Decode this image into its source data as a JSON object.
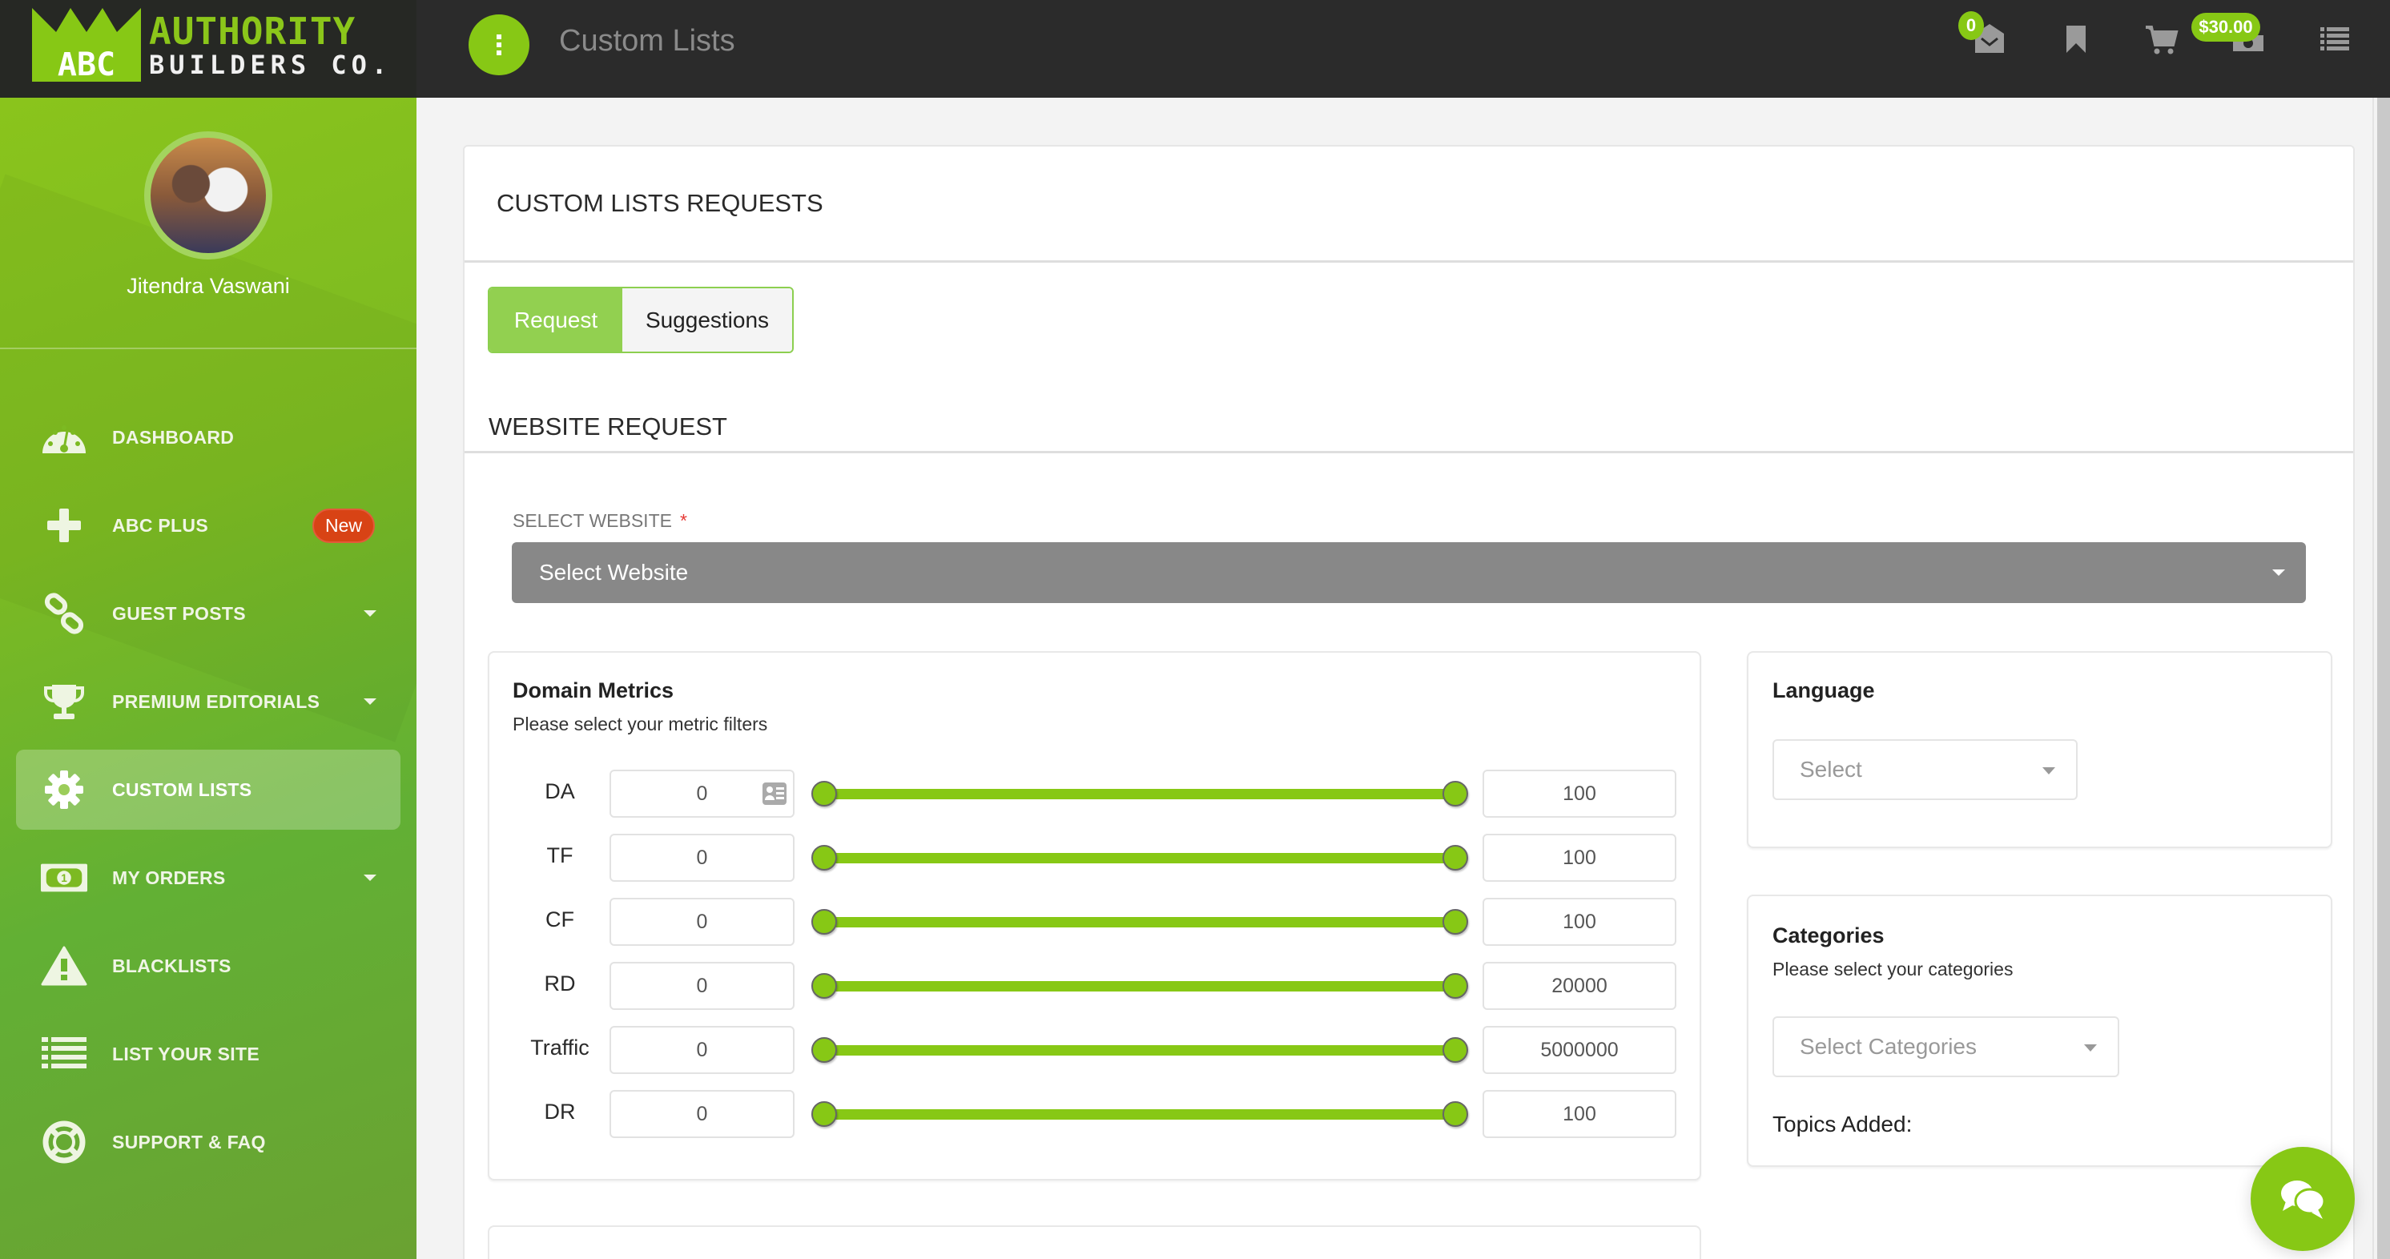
{
  "brand": {
    "logo_mark": "ABC",
    "logo_line1": "AUTHORITY",
    "logo_line2": "BUILDERS CO.",
    "accent_color": "#87c815"
  },
  "topbar": {
    "title": "Custom Lists",
    "menu_icon": "vertical-dots-icon",
    "icons": [
      {
        "name": "messages-icon",
        "badge": "0"
      },
      {
        "name": "bookmark-icon"
      },
      {
        "name": "cart-icon"
      },
      {
        "name": "wallet-icon",
        "badge": "$30.00"
      },
      {
        "name": "list-icon"
      }
    ]
  },
  "sidebar": {
    "user_name": "Jitendra Vaswani",
    "items": [
      {
        "label": "DASHBOARD",
        "icon": "dashboard-gauge-icon",
        "has_caret": false
      },
      {
        "label": "ABC PLUS",
        "icon": "plus-icon",
        "badge": "New",
        "has_caret": false
      },
      {
        "label": "GUEST POSTS",
        "icon": "link-icon",
        "has_caret": true
      },
      {
        "label": "PREMIUM EDITORIALS",
        "icon": "trophy-icon",
        "has_caret": true
      },
      {
        "label": "CUSTOM LISTS",
        "icon": "gear-icon",
        "active": true,
        "has_caret": false
      },
      {
        "label": "MY ORDERS",
        "icon": "money-icon",
        "has_caret": true
      },
      {
        "label": "BLACKLISTS",
        "icon": "warning-icon",
        "has_caret": false
      },
      {
        "label": "LIST YOUR SITE",
        "icon": "list-icon",
        "has_caret": false
      },
      {
        "label": "SUPPORT & FAQ",
        "icon": "lifebuoy-icon",
        "has_caret": false
      }
    ]
  },
  "main": {
    "card_title": "CUSTOM LISTS REQUESTS",
    "tabs": [
      {
        "label": "Request",
        "active": true
      },
      {
        "label": "Suggestions",
        "active": false
      }
    ],
    "section_title": "WEBSITE REQUEST",
    "select_website": {
      "label": "SELECT WEBSITE",
      "required_mark": "*",
      "value": "Select Website"
    },
    "domain_metrics": {
      "title": "Domain Metrics",
      "subtitle": "Please select your metric filters",
      "rows": [
        {
          "label": "DA",
          "min": "0",
          "max": "100",
          "range_fraction": [
            0,
            1
          ]
        },
        {
          "label": "TF",
          "min": "0",
          "max": "100",
          "range_fraction": [
            0,
            1
          ]
        },
        {
          "label": "CF",
          "min": "0",
          "max": "100",
          "range_fraction": [
            0,
            1
          ]
        },
        {
          "label": "RD",
          "min": "0",
          "max": "20000",
          "range_fraction": [
            0,
            1
          ]
        },
        {
          "label": "Traffic",
          "min": "0",
          "max": "5000000",
          "range_fraction": [
            0,
            1
          ]
        },
        {
          "label": "DR",
          "min": "0",
          "max": "100",
          "range_fraction": [
            0,
            1
          ]
        }
      ]
    },
    "language": {
      "title": "Language",
      "placeholder": "Select"
    },
    "categories": {
      "title": "Categories",
      "subtitle": "Please select your categories",
      "placeholder": "Select Categories",
      "topics_label": "Topics Added:"
    },
    "chat_icon": "chat-bubbles-icon"
  }
}
